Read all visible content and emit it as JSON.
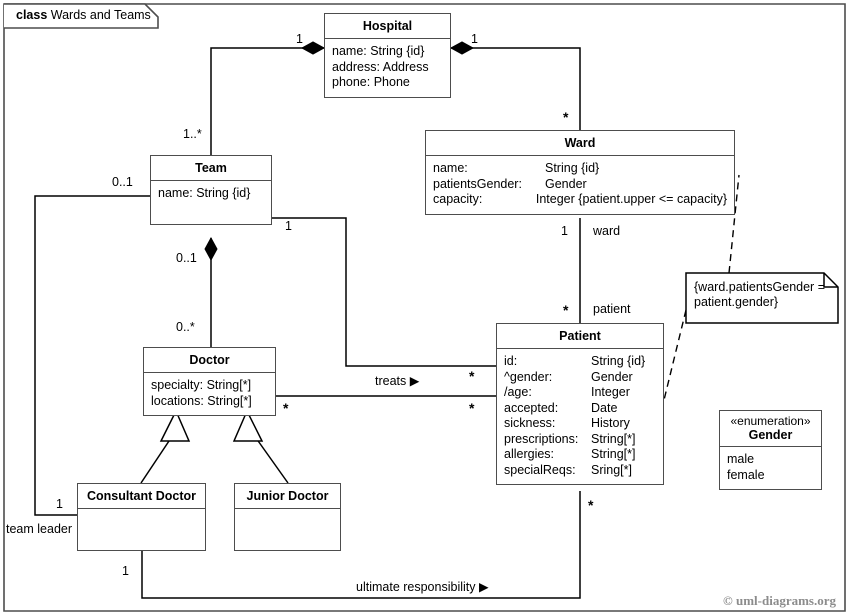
{
  "frame": {
    "keyword": "class",
    "name": "Wards and Teams"
  },
  "classes": {
    "hospital": {
      "name": "Hospital",
      "attributes": [
        "name: String {id}",
        "address: Address",
        "phone: Phone"
      ]
    },
    "ward": {
      "name": "Ward",
      "attributes": [
        {
          "name": "name:",
          "type": "String {id}"
        },
        {
          "name": "patientsGender:",
          "type": "Gender"
        },
        {
          "name": "capacity:",
          "type": "Integer {patient.upper <= capacity}"
        }
      ]
    },
    "team": {
      "name": "Team",
      "attributes": [
        "name: String {id}"
      ]
    },
    "doctor": {
      "name": "Doctor",
      "attributes": [
        "specialty: String[*]",
        "locations: String[*]"
      ]
    },
    "patient": {
      "name": "Patient",
      "attributes": [
        {
          "name": "id:",
          "type": "String {id}"
        },
        {
          "name": "^gender:",
          "type": "Gender"
        },
        {
          "name": "/age:",
          "type": "Integer"
        },
        {
          "name": "accepted:",
          "type": "Date"
        },
        {
          "name": "sickness:",
          "type": "History"
        },
        {
          "name": "prescriptions:",
          "type": "String[*]"
        },
        {
          "name": "allergies:",
          "type": "String[*]"
        },
        {
          "name": "specialReqs:",
          "type": "Sring[*]"
        }
      ]
    },
    "consultant_doctor": {
      "name": "Consultant Doctor",
      "attributes": []
    },
    "junior_doctor": {
      "name": "Junior Doctor",
      "attributes": []
    },
    "gender": {
      "stereotype": "«enumeration»",
      "name": "Gender",
      "literals": [
        "male",
        "female"
      ]
    }
  },
  "note": {
    "text": "{ward.patientsGender = patient.gender}"
  },
  "labels": {
    "hospital_team_mult": "1",
    "team_hospital_mult": "1..*",
    "hospital_ward_mult": "1",
    "ward_hospital_mult": "*",
    "team_leader_mult": "0..1",
    "team_doctor_mult": "0..1",
    "doctor_team_mult": "0..*",
    "team_treats_mult": "1",
    "treats_name": "treats ▶",
    "treats_patient_mult": "*",
    "doctor_patient_mult": "*",
    "patient_doctor_mult": "*",
    "ward_patient_ward_mult": "1",
    "ward_patient_ward_role": "ward",
    "ward_patient_patient_mult": "*",
    "ward_patient_patient_role": "patient",
    "team_leader_role": "team leader",
    "team_leader_consultant_mult": "1",
    "responsibility_consultant_mult": "1",
    "responsibility_name": "ultimate responsibility ▶",
    "responsibility_patient_mult": "*"
  },
  "copyright": "© uml-diagrams.org",
  "colors": {
    "border": "#4d4d4d",
    "line": "#000000",
    "background": "#ffffff",
    "copyright": "#8c8c8c"
  }
}
